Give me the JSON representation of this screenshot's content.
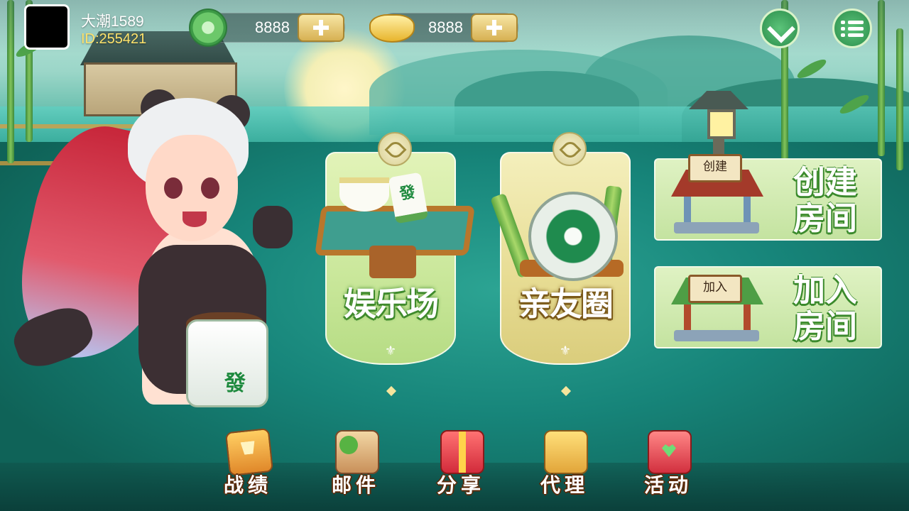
{
  "user": {
    "nickname": "大潮1589",
    "id_label": "ID:255421"
  },
  "currencies": [
    {
      "icon": "jade-icon",
      "amount": "8888"
    },
    {
      "icon": "gold-ingot-icon",
      "amount": "8888"
    }
  ],
  "modes": {
    "entertainment": {
      "title": "娱乐场",
      "tile_glyph": "發"
    },
    "friends": {
      "title": "亲友圈"
    }
  },
  "rooms": {
    "create": {
      "sign": "创建",
      "label_line1": "创建",
      "label_line2": "房间"
    },
    "join": {
      "sign": "加入",
      "label_line1": "加入",
      "label_line2": "房间"
    }
  },
  "mascot_tile_glyph": "發",
  "bottom_nav": [
    {
      "key": "record",
      "label": "战绩"
    },
    {
      "key": "mail",
      "label": "邮件"
    },
    {
      "key": "share",
      "label": "分享"
    },
    {
      "key": "agent",
      "label": "代理"
    },
    {
      "key": "event",
      "label": "活动"
    }
  ],
  "colors": {
    "accent_green": "#3b8a2c",
    "gold": "#ffe36b",
    "button_gold": "#d7b153"
  }
}
